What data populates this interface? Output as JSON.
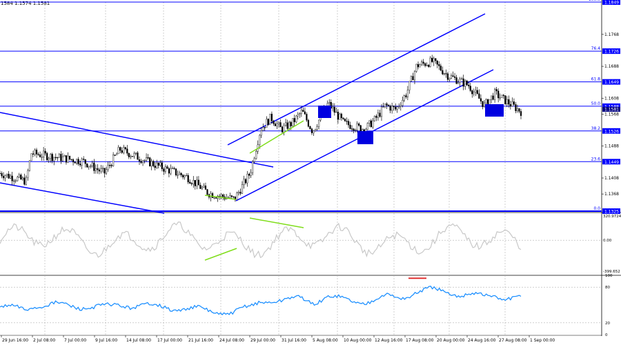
{
  "header": {
    "symbol_info": "1584 1.1574 1.1581"
  },
  "colors": {
    "background": "#ffffff",
    "grid": "#b0b0b0",
    "level": "#0000ff",
    "candle": "#000000",
    "cci": "#c8c8c8",
    "rsi": "#1e90ff",
    "green_line": "#7fdd1a",
    "red_line": "#e03030",
    "current_tag_bg": "#000080"
  },
  "chart_data": {
    "type": "candlestick",
    "price_axis": {
      "ylim": [
        1.1325,
        1.1849
      ],
      "tick_labels": [
        "1.1768",
        "1.1688",
        "1.1608",
        "1.1568",
        "1.1488",
        "1.1408",
        "1.1368"
      ]
    },
    "fibonacci_levels": [
      {
        "label": "100.0",
        "price": 1.1849
      },
      {
        "label": "76.4",
        "price": 1.1726
      },
      {
        "label": "61.8",
        "price": 1.1649
      },
      {
        "label": "50.0",
        "price": 1.1588
      },
      {
        "label": "38.2",
        "price": 1.1526
      },
      {
        "label": "23.6",
        "price": 1.1449
      },
      {
        "label": "0.0",
        "price": 1.1325
      }
    ],
    "current_price": "1.1581",
    "x_tick_labels": [
      "29 Jun 16:00",
      "2 Jul 08:00",
      "7 Jul 00:00",
      "9 Jul 16:00",
      "14 Jul 08:00",
      "17 Jul 00:00",
      "21 Jul 16:00",
      "24 Jul 08:00",
      "29 Jul 00:00",
      "31 Jul 16:00",
      "5 Aug 08:00",
      "10 Aug 00:00",
      "12 Aug 16:00",
      "17 Aug 08:00",
      "20 Aug 00:00",
      "24 Aug 16:00",
      "27 Aug 08:00",
      "1 Sep 00:00"
    ],
    "price_path": [
      [
        0,
        1.142
      ],
      [
        0.05,
        1.14
      ],
      [
        0.06,
        1.147
      ],
      [
        0.16,
        1.145
      ],
      [
        0.2,
        1.142
      ],
      [
        0.23,
        1.148
      ],
      [
        0.3,
        1.144
      ],
      [
        0.36,
        1.141
      ],
      [
        0.4,
        1.137
      ],
      [
        0.45,
        1.1355
      ],
      [
        0.48,
        1.142
      ],
      [
        0.5,
        1.153
      ],
      [
        0.52,
        1.156
      ],
      [
        0.54,
        1.153
      ],
      [
        0.56,
        1.1545
      ],
      [
        0.58,
        1.1575
      ],
      [
        0.6,
        1.1525
      ],
      [
        0.63,
        1.1595
      ],
      [
        0.66,
        1.1545
      ],
      [
        0.7,
        1.153
      ],
      [
        0.72,
        1.1555
      ],
      [
        0.74,
        1.159
      ],
      [
        0.76,
        1.158
      ],
      [
        0.78,
        1.162
      ],
      [
        0.8,
        1.169
      ],
      [
        0.83,
        1.17
      ],
      [
        0.86,
        1.1665
      ],
      [
        0.9,
        1.164
      ],
      [
        0.93,
        1.159
      ],
      [
        0.95,
        1.162
      ],
      [
        1,
        1.1575
      ]
    ],
    "cci": {
      "ylim": [
        -399.652,
        320.9724
      ],
      "tick_labels": [
        "320.9724",
        "0.00",
        "-399.652"
      ]
    },
    "rsi": {
      "ylim": [
        0,
        100
      ],
      "tick_labels": [
        "100",
        "80",
        "20",
        "0"
      ]
    }
  }
}
